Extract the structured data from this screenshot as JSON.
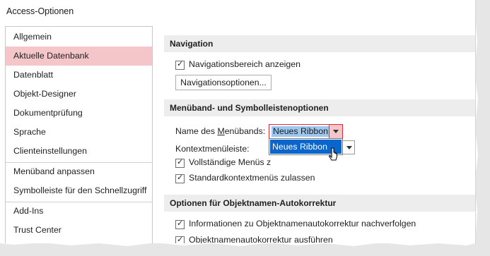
{
  "window": {
    "title": "Access-Optionen"
  },
  "sidebar": {
    "items": [
      {
        "label": "Allgemein"
      },
      {
        "label": "Aktuelle Datenbank",
        "selected": true
      },
      {
        "label": "Datenblatt"
      },
      {
        "label": "Objekt-Designer"
      },
      {
        "label": "Dokumentprüfung"
      },
      {
        "label": "Sprache"
      },
      {
        "label": "Clienteinstellungen"
      },
      {
        "label": "Menüband anpassen"
      },
      {
        "label": "Symbolleiste für den Schnellzugriff"
      },
      {
        "label": "Add-Ins"
      },
      {
        "label": "Trust Center"
      }
    ]
  },
  "navigation": {
    "header": "Navigation",
    "show_nav_pane": {
      "label": "Navigationsbereich anzeigen",
      "checked": true
    },
    "nav_options_button": "Navigationsoptionen..."
  },
  "ribbon_options": {
    "header": "Menüband- und Symbolleistenoptionen",
    "ribbon_name_label_pre": "Name des ",
    "ribbon_name_label_key": "M",
    "ribbon_name_label_post": "enübands:",
    "ribbon_name_value": "Neues Ribbon",
    "context_menu_label": "Kontextmenüleiste:",
    "dropdown_options": [
      "Neues Ribbon"
    ],
    "full_menus": {
      "label": "Vollständige Menüs z",
      "checked": true
    },
    "default_context_menus": {
      "label": "Standardkontextmenüs zulassen",
      "checked": true
    }
  },
  "autocorrect": {
    "header": "Optionen für Objektnamen-Autokorrektur",
    "track_info": {
      "label": "Informationen zu Objektnamenautokorrektur nachverfolgen",
      "checked": true
    },
    "perform": {
      "label": "Objektnamenautokorrektur ausführen",
      "checked": true
    }
  },
  "colors": {
    "selected_bg": "#f5c6c9",
    "accent_red": "#d92d3a",
    "highlight_blue": "#0a66cc",
    "section_bg": "#ededed"
  },
  "icons": {
    "check": "check-icon",
    "dropdown": "chevron-down-icon",
    "cursor": "mouse-pointer-icon"
  }
}
